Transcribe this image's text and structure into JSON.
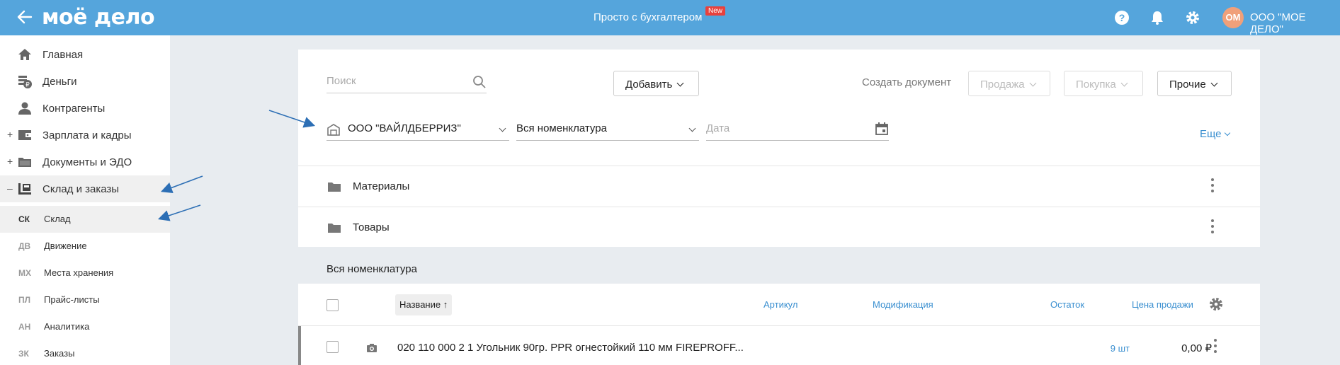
{
  "header": {
    "logo": "моё дело",
    "center_title": "Просто с бухгалтером",
    "new_badge": "New",
    "avatar_initials": "ОМ",
    "org_name": "ООО \"МОЕ ДЕЛО\"",
    "icons": [
      "back-arrow-icon",
      "help-icon",
      "bell-icon",
      "gear-icon"
    ],
    "accent": "#55a5dc"
  },
  "sidebar": {
    "items": [
      {
        "label": "Главная",
        "icon": "home-icon",
        "expand": ""
      },
      {
        "label": "Деньги",
        "icon": "money-icon",
        "expand": ""
      },
      {
        "label": "Контрагенты",
        "icon": "person-icon",
        "expand": ""
      },
      {
        "label": "Зарплата и кадры",
        "icon": "wallet-icon",
        "expand": "+"
      },
      {
        "label": "Документы и ЭДО",
        "icon": "folder-icon",
        "expand": "+"
      },
      {
        "label": "Склад и заказы",
        "icon": "warehouse-icon",
        "expand": "–"
      }
    ],
    "subitems": [
      {
        "abbr": "СК",
        "label": "Склад"
      },
      {
        "abbr": "ДВ",
        "label": "Движение"
      },
      {
        "abbr": "МХ",
        "label": "Места хранения"
      },
      {
        "abbr": "ПЛ",
        "label": "Прайс-листы"
      },
      {
        "abbr": "АН",
        "label": "Аналитика"
      },
      {
        "abbr": "ЗК",
        "label": "Заказы"
      }
    ]
  },
  "toolbar": {
    "search_placeholder": "Поиск",
    "add_label": "Добавить",
    "create_doc_label": "Создать документ",
    "sale_label": "Продажа",
    "purchase_label": "Покупка",
    "other_label": "Прочие"
  },
  "filters": {
    "counterparty": "ООО \"ВАЙЛДБЕРРИЗ\"",
    "nomenclature": "Вся номенклатура",
    "date_placeholder": "Дата",
    "more_label": "Еще"
  },
  "folders": [
    {
      "label": "Материалы"
    },
    {
      "label": "Товары"
    }
  ],
  "section_title": "Вся номенклатура",
  "table": {
    "columns": {
      "name": "Название ↑",
      "article": "Артикул",
      "modification": "Модификация",
      "stock": "Остаток",
      "price": "Цена продажи"
    },
    "rows": [
      {
        "name": "020 110 000 2 1 Угольник 90гр. PPR огнестойкий 110 мм FIREPROFF...",
        "stock": "9 шт",
        "price": "0,00 ₽"
      }
    ]
  }
}
